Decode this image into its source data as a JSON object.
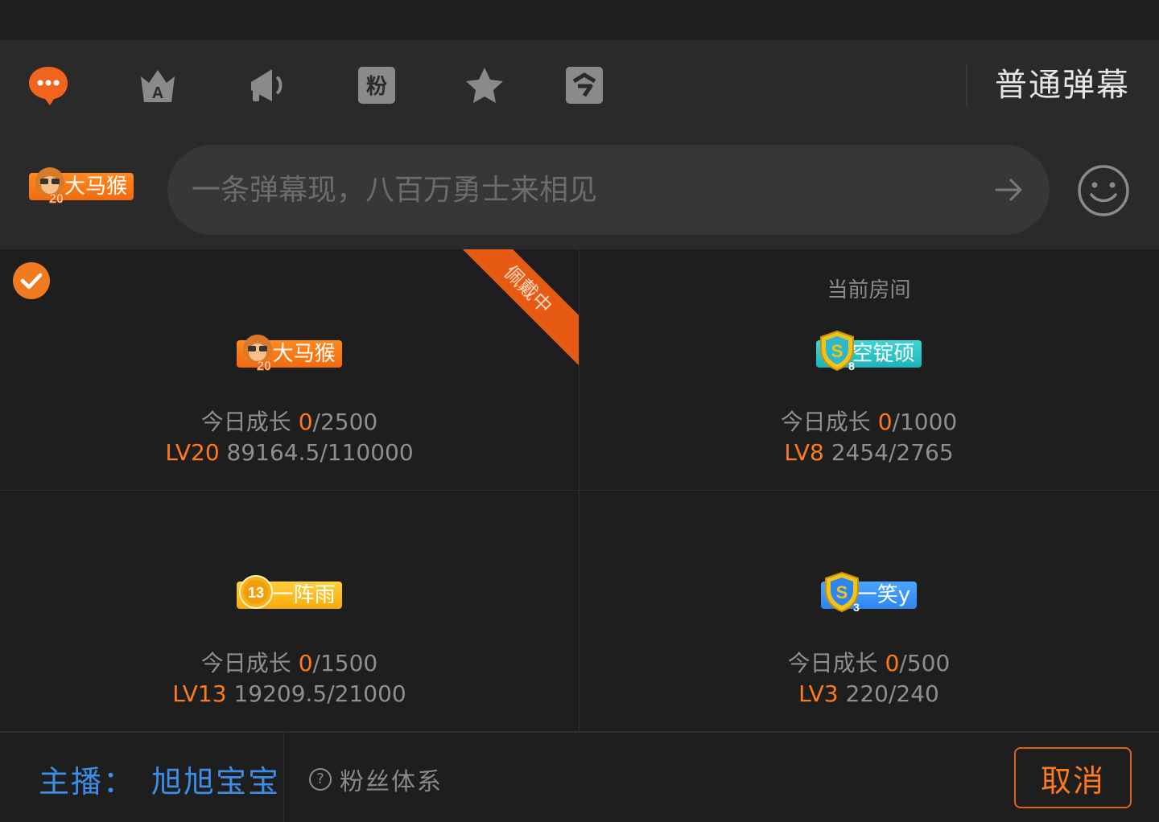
{
  "toolbar": {
    "icons": [
      "chat-bubble-icon",
      "crown-a-icon",
      "megaphone-icon",
      "fan-badge-icon",
      "star-icon",
      "command-icon"
    ],
    "mode_label": "普通弹幕"
  },
  "input": {
    "placeholder": "一条弹幕现，八百万勇士来相见",
    "user_badge": "大马猴",
    "user_badge_level": "20"
  },
  "badges": [
    {
      "name": "大马猴",
      "level_icon": "20",
      "selected": true,
      "ribbon": "佩戴中",
      "room_label": "",
      "today_label": "今日成长",
      "today_value": "0",
      "today_max": "/2500",
      "level": "LV20",
      "progress": "89164.5/110000",
      "color": "#f26a10"
    },
    {
      "name": "空锭硕",
      "level_icon": "8",
      "selected": false,
      "ribbon": "",
      "room_label": "当前房间",
      "today_label": "今日成长",
      "today_value": "0",
      "today_max": "/1000",
      "level": "LV8",
      "progress": "2454/2765",
      "color": "#1fb3b8"
    },
    {
      "name": "一阵雨",
      "level_icon": "13",
      "selected": false,
      "ribbon": "",
      "room_label": "",
      "today_label": "今日成长",
      "today_value": "0",
      "today_max": "/1500",
      "level": "LV13",
      "progress": "19209.5/21000",
      "color": "#f7a90d"
    },
    {
      "name": "一笑y",
      "level_icon": "3",
      "selected": false,
      "ribbon": "",
      "room_label": "",
      "today_label": "今日成长",
      "today_value": "0",
      "today_max": "/500",
      "level": "LV3",
      "progress": "220/240",
      "color": "#2d86f0"
    }
  ],
  "footer": {
    "anchor_label": "主播：",
    "anchor_name": "旭旭宝宝",
    "fans_link": "粉丝体系",
    "help_glyph": "?",
    "cancel": "取消"
  },
  "colors": {
    "accent": "#ff7a1a",
    "link_blue": "#3d8ee6",
    "background": "#1e1e1e"
  }
}
